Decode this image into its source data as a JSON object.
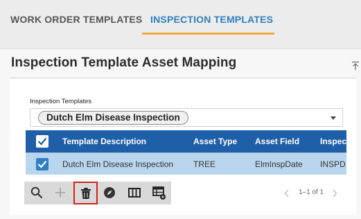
{
  "tabs": [
    {
      "label": "WORK ORDER TEMPLATES",
      "active": false
    },
    {
      "label": "INSPECTION TEMPLATES",
      "active": true
    }
  ],
  "panel": {
    "title": "Inspection Template Asset Mapping"
  },
  "templates_field": {
    "label": "Inspection Templates",
    "selected": "Dutch Elm Disease Inspection"
  },
  "table": {
    "columns": [
      "Template Description",
      "Asset Type",
      "Asset Field",
      "Inspec"
    ],
    "rows": [
      {
        "description": "Dutch Elm Disease Inspection",
        "asset_type": "TREE",
        "asset_field": "ElmInspDate",
        "inspection": "INSPD",
        "selected": true
      }
    ]
  },
  "toolbar": {
    "buttons": [
      "search-icon",
      "add-icon",
      "delete-icon",
      "compass-icon",
      "columns-icon",
      "table-settings-icon"
    ]
  },
  "pager": {
    "text": "1–1 of 1"
  },
  "colors": {
    "accent": "#2f7fbf",
    "tab_underline": "#f2a93b",
    "header_bg": "#1f5fa8",
    "selected_row": "#b9d6ee",
    "highlight_border": "#d32020"
  }
}
